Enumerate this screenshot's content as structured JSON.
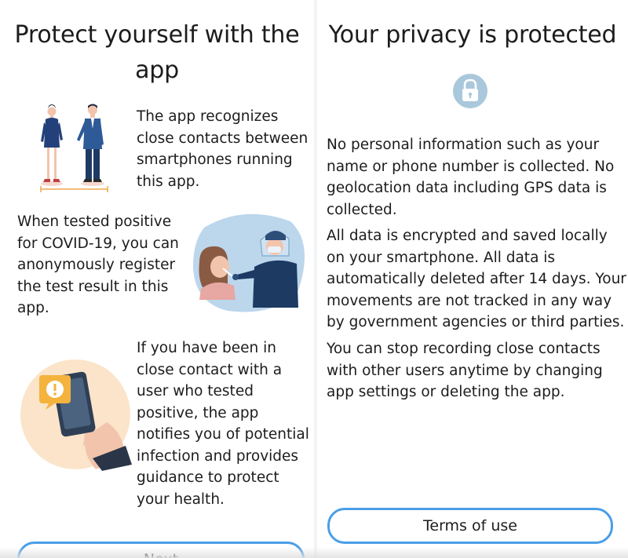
{
  "left_panel": {
    "title": "Protect yourself with the app",
    "paragraph_1": "The app recognizes close contacts between smartphones running this app.",
    "paragraph_2": "When tested positive for COVID-19, you can anonymously register the test result in this app.",
    "paragraph_3": "If you have been in close contact with a user who tested positive, the app notifies you of potential infection and provides guidance to protect your health.",
    "next_button_label": "Next",
    "illustrations": [
      "people-distance-icon",
      "covid-test-icon",
      "phone-alert-icon"
    ]
  },
  "right_panel": {
    "title": "Your privacy is protected",
    "lock_icon": "lock-icon",
    "paragraph_1": "No personal information such as your name or phone number is collected. No geolocation data including GPS data is collected.",
    "paragraph_2": "All data is encrypted and saved locally on your smartphone. All data is automatically deleted after 14 days. Your movements are not tracked in any way by government agencies or third parties.",
    "paragraph_3": "You can stop recording close contacts with other users anytime by changing app settings or deleting the app.",
    "terms_button_label": "Terms of use"
  },
  "colors": {
    "accent_button_border": "#4a9ee8",
    "lock_circle": "#aac8dc",
    "illustration_blue": "#a7c9e6",
    "navy": "#1e3a64",
    "skin": "#f2c4ac",
    "alert_yellow": "#f3b33d"
  }
}
